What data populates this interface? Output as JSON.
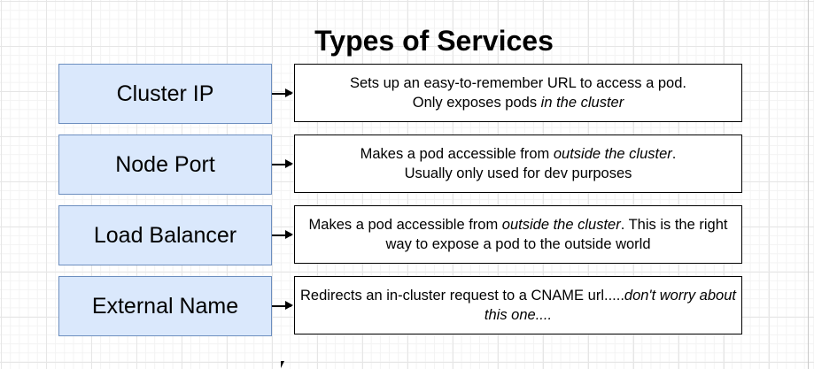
{
  "title": "Types of Services",
  "services": [
    {
      "name": "Cluster IP",
      "desc": [
        {
          "t": "Sets up an easy-to-remember URL to access a pod."
        },
        {
          "br": true
        },
        {
          "t": "Only exposes pods "
        },
        {
          "t": "in the cluster",
          "i": true
        }
      ]
    },
    {
      "name": "Node Port",
      "desc": [
        {
          "t": "Makes a pod accessible from "
        },
        {
          "t": "outside the cluster",
          "i": true
        },
        {
          "t": "."
        },
        {
          "br": true
        },
        {
          "t": "Usually only used for dev purposes"
        }
      ]
    },
    {
      "name": "Load Balancer",
      "desc": [
        {
          "t": "Makes a pod accessible from "
        },
        {
          "t": "outside the cluster",
          "i": true
        },
        {
          "t": ".  This is the right way to expose a pod to the outside world"
        }
      ]
    },
    {
      "name": "External Name",
      "desc": [
        {
          "t": "Redirects an in-cluster request to a CNAME url....."
        },
        {
          "t": "don't worry about this one....",
          "i": true
        }
      ]
    }
  ]
}
